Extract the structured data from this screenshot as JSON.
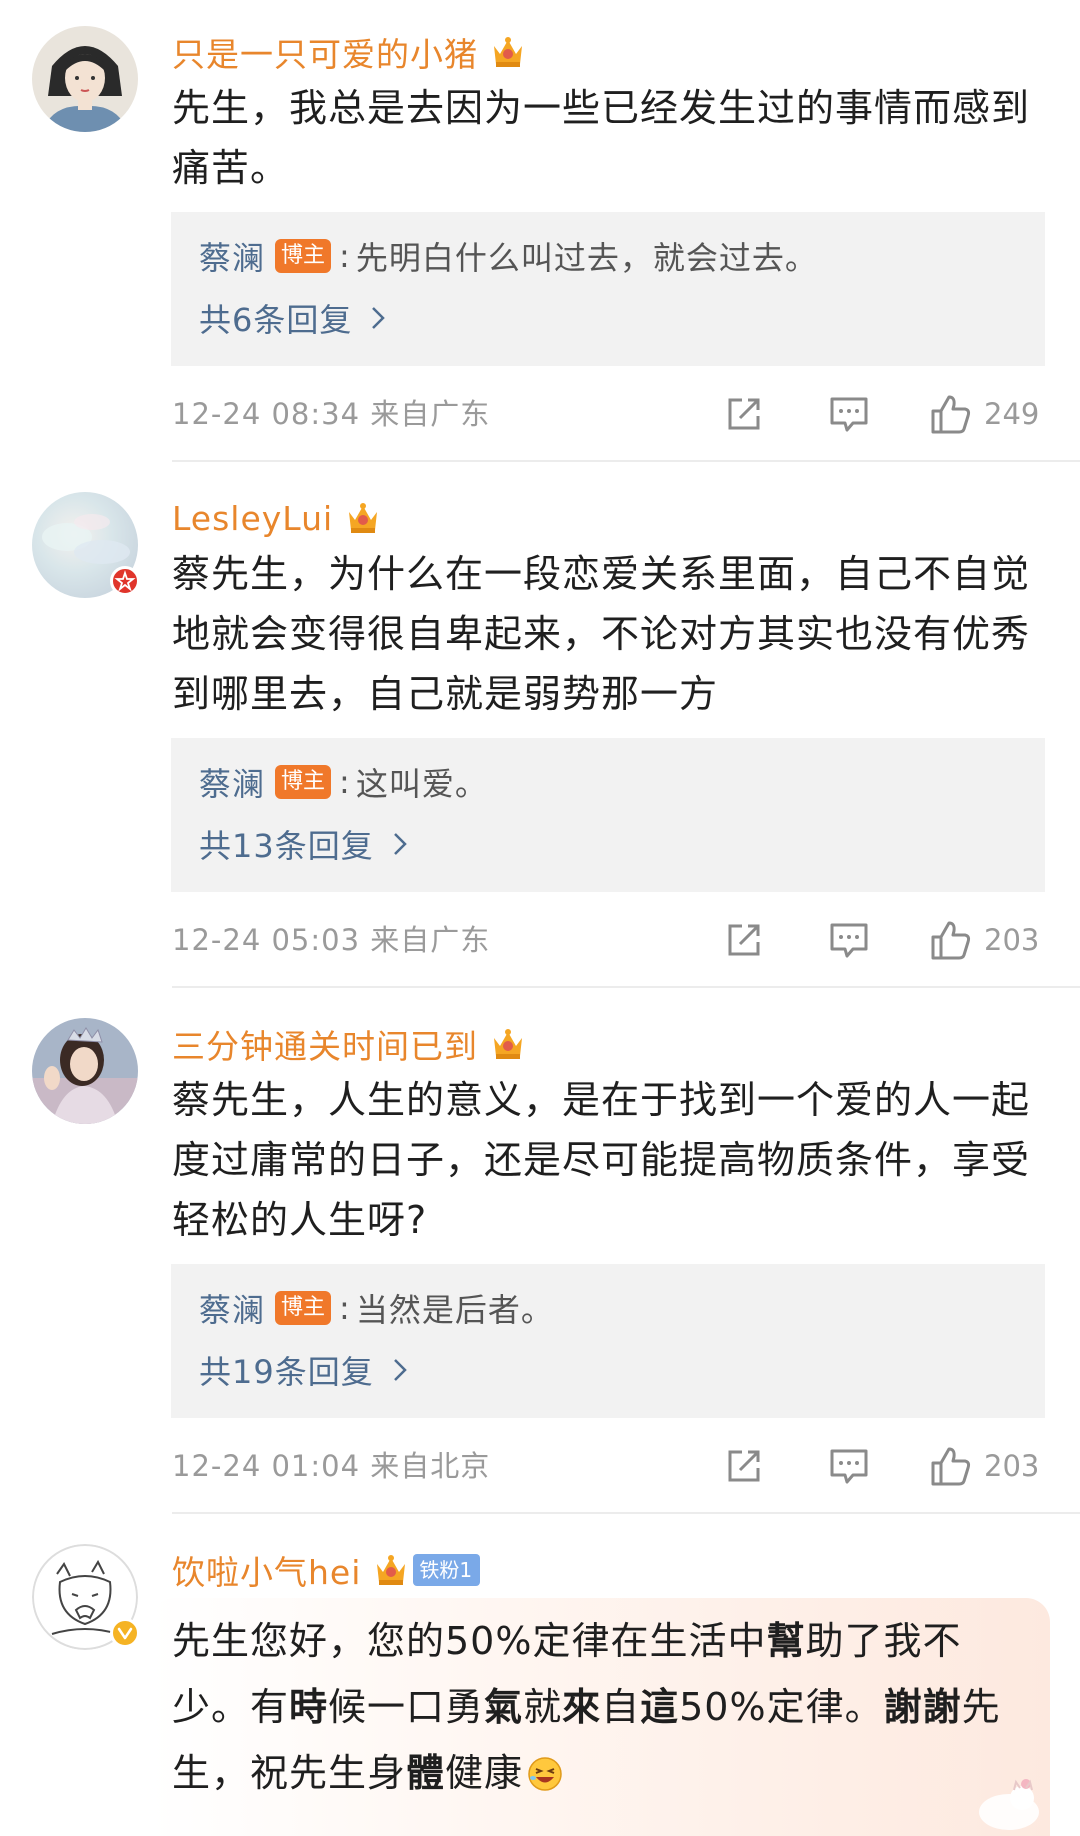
{
  "comments": [
    {
      "username": "只是一只可爱的小猪",
      "text": "先生，我总是去因为一些已经发生过的事情而感到痛苦。",
      "reply": {
        "author": "蔡澜",
        "badge": "博主",
        "colon": ":",
        "text": "先明白什么叫过去，就会过去。",
        "count": "共6条回复"
      },
      "meta": "12-24 08:34 来自广东",
      "likes": "249"
    },
    {
      "username": "LesleyLui",
      "text": "蔡先生，为什么在一段恋爱关系里面，自己不自觉地就会变得很自卑起来，不论对方其实也没有优秀到哪里去，自己就是弱势那一方",
      "reply": {
        "author": "蔡澜",
        "badge": "博主",
        "colon": ":",
        "text": "这叫爱。",
        "count": "共13条回复"
      },
      "meta": "12-24 05:03 来自广东",
      "likes": "203"
    },
    {
      "username": "三分钟通关时间已到",
      "text": "蔡先生，人生的意义，是在于找到一个爱的人一起度过庸常的日子，还是尽可能提高物质条件，享受轻松的人生呀?",
      "reply": {
        "author": "蔡澜",
        "badge": "博主",
        "colon": ":",
        "text": "当然是后者。",
        "count": "共19条回复"
      },
      "meta": "12-24 01:04 来自北京",
      "likes": "203"
    },
    {
      "username": "饮啦小气hei",
      "fan_badge": "铁粉1",
      "text_parts": [
        "先生您好，您的50%定律在生活中",
        "幫",
        "助了我不少。有",
        "時",
        "候一口勇",
        "氣",
        "就",
        "來",
        "自",
        "這",
        "50%定律。",
        "謝謝",
        "先生，祝先生身",
        "體",
        "健康"
      ]
    }
  ],
  "icons": {
    "share": "share-icon",
    "comment": "comment-icon",
    "like": "thumbs-up-icon",
    "crown": "crown-badge-icon",
    "chevron": "chevron-right-icon"
  },
  "colors": {
    "username": "#e8862c",
    "reply_link": "#4e6c8f",
    "blogger_badge": "#f0782a",
    "fan_badge": "#7aa9e8",
    "meta": "#9a9a9a",
    "reply_bg": "#f2f2f2"
  }
}
